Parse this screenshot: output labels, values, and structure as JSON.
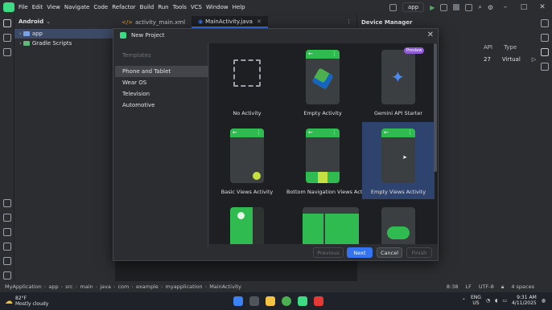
{
  "menu": [
    "File",
    "Edit",
    "View",
    "Navigate",
    "Code",
    "Refactor",
    "Build",
    "Run",
    "Tools",
    "VCS",
    "Window",
    "Help"
  ],
  "toolbar": {
    "run_config": "app"
  },
  "project": {
    "view": "Android",
    "items": [
      {
        "label": "app",
        "selected": true
      },
      {
        "label": "Gradle Scripts",
        "selected": false
      }
    ]
  },
  "editor": {
    "tabs": [
      {
        "label": "activity_main.xml",
        "active": false
      },
      {
        "label": "MainActivity.java",
        "active": true
      }
    ]
  },
  "device_manager": {
    "title": "Device Manager",
    "columns": [
      "API",
      "Type"
    ],
    "row": {
      "api": "27",
      "type": "Virtual"
    }
  },
  "dialog": {
    "title": "New Project",
    "sidebar_heading": "Templates",
    "categories": [
      {
        "label": "Phone and Tablet",
        "selected": true
      },
      {
        "label": "Wear OS",
        "selected": false
      },
      {
        "label": "Television",
        "selected": false
      },
      {
        "label": "Automotive",
        "selected": false
      }
    ],
    "templates": [
      {
        "label": "No Activity",
        "kind": "empty-dashed"
      },
      {
        "label": "Empty Activity",
        "kind": "compose"
      },
      {
        "label": "Gemini API Starter",
        "kind": "gemini",
        "badge": "Preview"
      },
      {
        "label": "Basic Views Activity",
        "kind": "fab"
      },
      {
        "label": "Bottom Navigation Views Activity",
        "kind": "bottom-nav"
      },
      {
        "label": "Empty Views Activity",
        "kind": "views",
        "selected": true
      },
      {
        "label": "",
        "kind": "list"
      },
      {
        "label": "",
        "kind": "grid"
      },
      {
        "label": "",
        "kind": "game"
      }
    ],
    "buttons": {
      "previous": "Previous",
      "next": "Next",
      "cancel": "Cancel",
      "finish": "Finish"
    }
  },
  "status": {
    "breadcrumb": [
      "MyApplication",
      "app",
      "src",
      "main",
      "java",
      "com",
      "example",
      "myapplication",
      "MainActivity"
    ],
    "position": "8:38",
    "line_sep": "LF",
    "encoding": "UTF-8",
    "indent": "4 spaces"
  },
  "taskbar": {
    "weather_temp": "82°F",
    "weather_desc": "Mostly cloudy",
    "lang": "ENG",
    "region": "US",
    "time": "9:31 AM",
    "date": "4/11/2025"
  },
  "colors": {
    "accent": "#3574f0",
    "android_green": "#2fbb4f",
    "selection": "#2e436e"
  }
}
